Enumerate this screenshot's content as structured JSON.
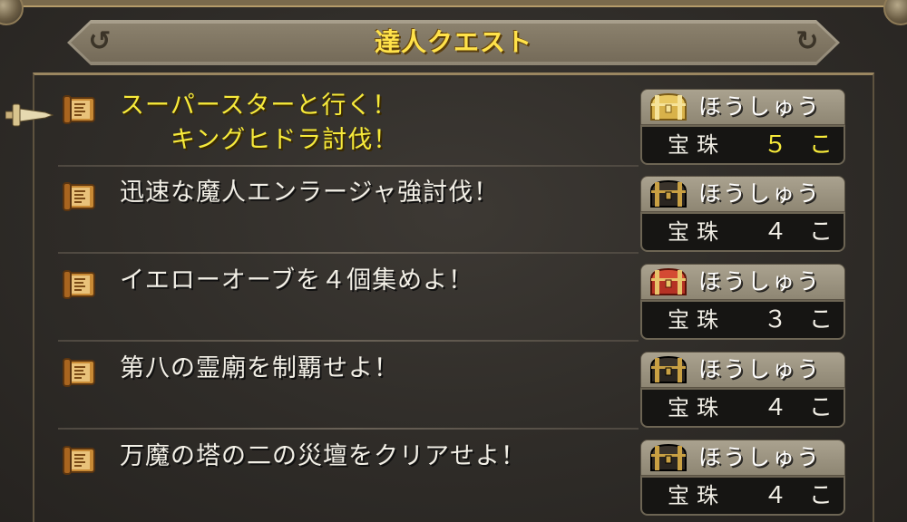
{
  "window": {
    "title": "達人クエスト"
  },
  "quests": [
    {
      "name": "スーパースターと行く！\n　　キングヒドラ討伐！",
      "selected": true,
      "reward": {
        "label": "ほうしゅう",
        "item": "宝珠",
        "count": "５ こ",
        "chest": "gold-chest-icon"
      }
    },
    {
      "name": "迅速な魔人エンラージャ強討伐！",
      "selected": false,
      "reward": {
        "label": "ほうしゅう",
        "item": "宝珠",
        "count": "４ こ",
        "chest": "black-chest-icon"
      }
    },
    {
      "name": "イエローオーブを４個集めよ！",
      "selected": false,
      "reward": {
        "label": "ほうしゅう",
        "item": "宝珠",
        "count": "３ こ",
        "chest": "red-chest-icon"
      }
    },
    {
      "name": "第八の霊廟を制覇せよ！",
      "selected": false,
      "reward": {
        "label": "ほうしゅう",
        "item": "宝珠",
        "count": "４ こ",
        "chest": "black-chest-icon"
      }
    },
    {
      "name": "万魔の塔の二の災壇をクリアせよ！",
      "selected": false,
      "reward": {
        "label": "ほうしゅう",
        "item": "宝珠",
        "count": "４ こ",
        "chest": "black-chest-icon"
      }
    }
  ],
  "colors": {
    "selected_text": "#f7ea3a",
    "normal_text": "#f2efe6",
    "title_text": "#ffe24a"
  }
}
